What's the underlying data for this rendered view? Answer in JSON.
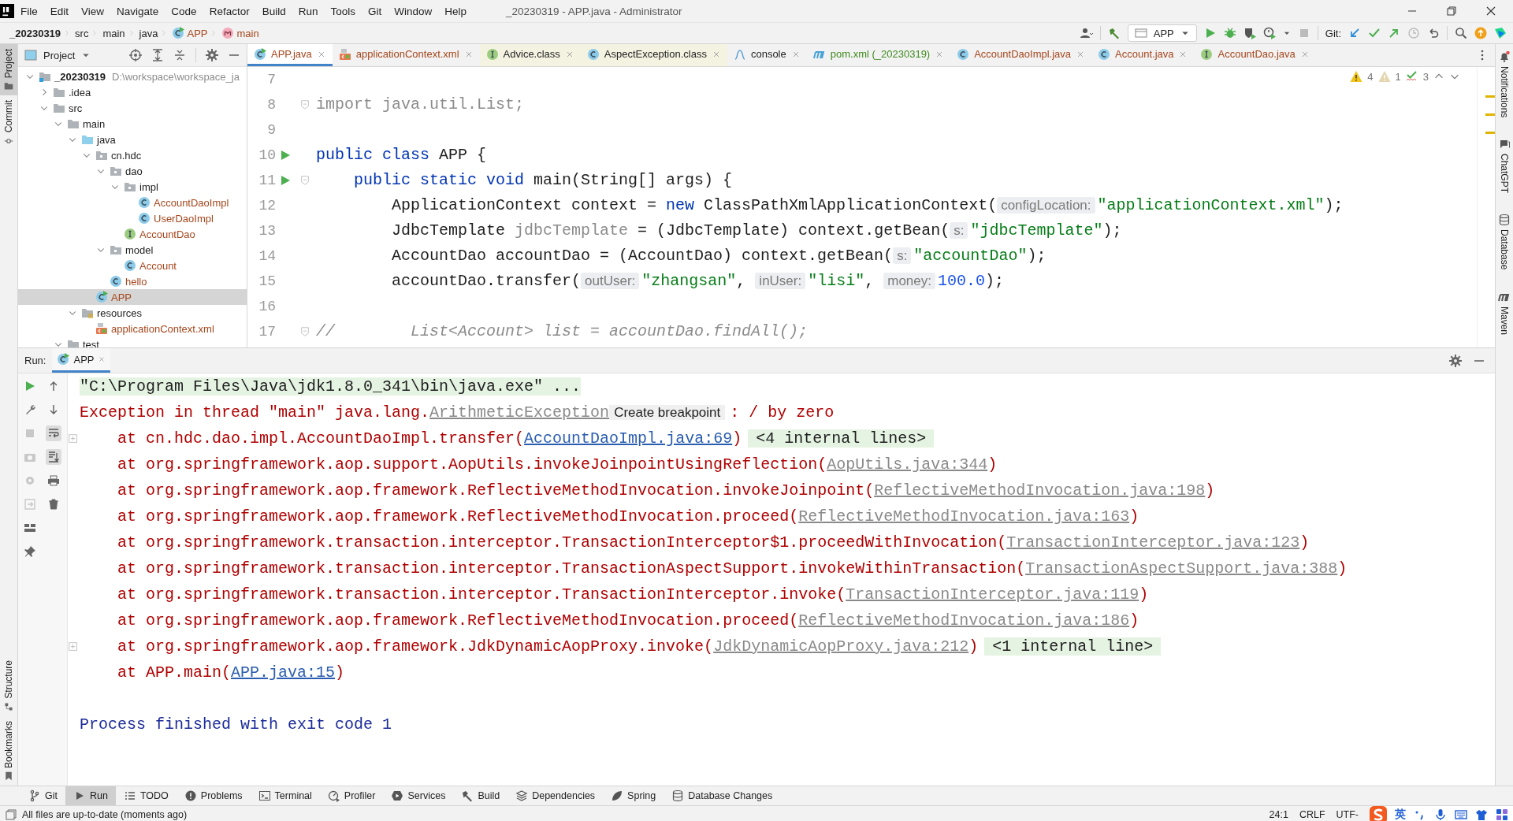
{
  "window": {
    "title": "_20230319 - APP.java - Administrator"
  },
  "menu": [
    "File",
    "Edit",
    "View",
    "Navigate",
    "Code",
    "Refactor",
    "Build",
    "Run",
    "Tools",
    "Git",
    "Window",
    "Help"
  ],
  "breadcrumbs": [
    {
      "label": "_20230319",
      "kind": "project"
    },
    {
      "label": "src",
      "kind": "folder"
    },
    {
      "label": "main",
      "kind": "folder"
    },
    {
      "label": "java",
      "kind": "folder"
    },
    {
      "label": "APP",
      "kind": "class"
    },
    {
      "label": "main",
      "kind": "method"
    }
  ],
  "toolbar": {
    "run_config": "APP",
    "git_label": "Git:"
  },
  "left_tool_strip": {
    "top": [
      {
        "label": "Project",
        "selected": true
      },
      {
        "label": "Commit",
        "selected": false
      }
    ],
    "bottom": [
      {
        "label": "Structure",
        "selected": false
      },
      {
        "label": "Bookmarks",
        "selected": false
      }
    ]
  },
  "right_tool_strip": [
    {
      "label": "Notifications",
      "kind": "bell"
    },
    {
      "label": "ChatGPT",
      "kind": "chat"
    },
    {
      "label": "Database",
      "kind": "database"
    },
    {
      "label": "Maven",
      "kind": "maven"
    }
  ],
  "project_panel": {
    "title": "Project",
    "tree": [
      {
        "label": "_20230319",
        "kind": "module",
        "path": "D:\\workspace\\workspace_ja",
        "expanded": true,
        "selected": false,
        "children": [
          {
            "label": ".idea",
            "kind": "folder",
            "expanded": false,
            "selected": false
          },
          {
            "label": "src",
            "kind": "folder",
            "expanded": true,
            "selected": false,
            "children": [
              {
                "label": "main",
                "kind": "folder",
                "expanded": true,
                "selected": false,
                "children": [
                  {
                    "label": "java",
                    "kind": "source-root",
                    "expanded": true,
                    "selected": false,
                    "children": [
                      {
                        "label": "cn.hdc",
                        "kind": "package",
                        "expanded": true,
                        "selected": false,
                        "children": [
                          {
                            "label": "dao",
                            "kind": "package",
                            "expanded": true,
                            "selected": false,
                            "children": [
                              {
                                "label": "impl",
                                "kind": "package",
                                "expanded": true,
                                "selected": false,
                                "children": [
                                  {
                                    "label": "AccountDaoImpl",
                                    "kind": "class",
                                    "selected": false
                                  },
                                  {
                                    "label": "UserDaoImpl",
                                    "kind": "class",
                                    "selected": false
                                  }
                                ]
                              },
                              {
                                "label": "AccountDao",
                                "kind": "interface",
                                "selected": false
                              }
                            ]
                          },
                          {
                            "label": "model",
                            "kind": "package",
                            "expanded": true,
                            "selected": false,
                            "children": [
                              {
                                "label": "Account",
                                "kind": "class",
                                "selected": false
                              }
                            ]
                          },
                          {
                            "label": "hello",
                            "kind": "class",
                            "selected": false
                          }
                        ]
                      },
                      {
                        "label": "APP",
                        "kind": "main-class",
                        "selected": true
                      }
                    ]
                  },
                  {
                    "label": "resources",
                    "kind": "resource-root",
                    "expanded": true,
                    "selected": false,
                    "children": [
                      {
                        "label": "applicationContext.xml",
                        "kind": "xml",
                        "selected": false
                      }
                    ]
                  }
                ]
              },
              {
                "label": "test",
                "kind": "folder",
                "expanded": true,
                "selected": false
              }
            ]
          }
        ]
      }
    ]
  },
  "editor_tabs": [
    {
      "label": "APP.java",
      "kind": "main-class",
      "selected": true,
      "library": false,
      "color": "#a5461c"
    },
    {
      "label": "applicationContext.xml",
      "kind": "xml",
      "selected": false,
      "library": false,
      "color": "#a5461c"
    },
    {
      "label": "Advice.class",
      "kind": "interface",
      "selected": false,
      "library": true,
      "color": "#1e1e1e"
    },
    {
      "label": "AspectException.class",
      "kind": "class",
      "selected": false,
      "library": true,
      "color": "#1e1e1e"
    },
    {
      "label": "console",
      "kind": "console",
      "selected": false,
      "library": false,
      "color": "#1e1e1e"
    },
    {
      "label": "pom.xml (_20230319)",
      "kind": "maven",
      "selected": false,
      "library": false,
      "color": "#3f8a1d"
    },
    {
      "label": "AccountDaoImpl.java",
      "kind": "class",
      "selected": false,
      "library": false,
      "color": "#a5461c"
    },
    {
      "label": "Account.java",
      "kind": "class",
      "selected": false,
      "library": false,
      "color": "#a5461c"
    },
    {
      "label": "AccountDao.java",
      "kind": "interface",
      "selected": false,
      "library": false,
      "color": "#a5461c"
    }
  ],
  "inspections": {
    "warnings": "4",
    "weak_warnings": "1",
    "typos": "3"
  },
  "code": [
    {
      "number": "7",
      "run_marker": false,
      "foldable": false
    },
    {
      "number": "8",
      "run_marker": false,
      "foldable": true,
      "tokens": [
        {
          "kind": "unused",
          "text": "import java.util.List;"
        }
      ]
    },
    {
      "number": "9",
      "run_marker": false,
      "foldable": false
    },
    {
      "number": "10",
      "run_marker": true,
      "foldable": false,
      "tokens": [
        {
          "kind": "keyword",
          "text": "public class"
        },
        {
          "kind": "plain",
          "text": " APP {"
        }
      ]
    },
    {
      "number": "11",
      "run_marker": true,
      "foldable": true,
      "tokens": [
        {
          "kind": "keyword",
          "text": "    public static void"
        },
        {
          "kind": "plain",
          "text": " main(String[] args) {"
        }
      ]
    },
    {
      "number": "12",
      "run_marker": false,
      "foldable": false,
      "tokens": [
        {
          "kind": "plain",
          "text": "        ApplicationContext context = "
        },
        {
          "kind": "keyword",
          "text": "new"
        },
        {
          "kind": "plain",
          "text": " ClassPathXmlApplicationContext("
        },
        {
          "kind": "hint",
          "text": "configLocation:"
        },
        {
          "kind": "string",
          "text": "\"applicationContext.xml\""
        },
        {
          "kind": "plain",
          "text": ");"
        }
      ]
    },
    {
      "number": "13",
      "run_marker": false,
      "foldable": false,
      "tokens": [
        {
          "kind": "plain",
          "text": "        JdbcTemplate "
        },
        {
          "kind": "unused",
          "text": "jdbcTemplate"
        },
        {
          "kind": "plain",
          "text": " = (JdbcTemplate) context.getBean("
        },
        {
          "kind": "hint",
          "text": "s:"
        },
        {
          "kind": "string",
          "text": "\"jdbcTemplate\""
        },
        {
          "kind": "plain",
          "text": ");"
        }
      ]
    },
    {
      "number": "14",
      "run_marker": false,
      "foldable": false,
      "tokens": [
        {
          "kind": "plain",
          "text": "        AccountDao accountDao = (AccountDao) context.getBean("
        },
        {
          "kind": "hint",
          "text": "s:"
        },
        {
          "kind": "string",
          "text": "\"accountDao\""
        },
        {
          "kind": "plain",
          "text": ");"
        }
      ]
    },
    {
      "number": "15",
      "run_marker": false,
      "foldable": false,
      "tokens": [
        {
          "kind": "plain",
          "text": "        accountDao.transfer("
        },
        {
          "kind": "hint",
          "text": "outUser:"
        },
        {
          "kind": "string",
          "text": "\"zhangsan\""
        },
        {
          "kind": "plain",
          "text": ", "
        },
        {
          "kind": "hint",
          "text": "inUser:"
        },
        {
          "kind": "string",
          "text": "\"lisi\""
        },
        {
          "kind": "plain",
          "text": ", "
        },
        {
          "kind": "hint",
          "text": "money:"
        },
        {
          "kind": "number",
          "text": "100.0"
        },
        {
          "kind": "plain",
          "text": ");"
        }
      ]
    },
    {
      "number": "16",
      "run_marker": false,
      "foldable": false
    },
    {
      "number": "17",
      "run_marker": false,
      "foldable": true,
      "tokens": [
        {
          "kind": "comment",
          "text": "//        List<Account> list = accountDao.findAll();"
        }
      ]
    }
  ],
  "run_panel": {
    "title": "Run:",
    "tab": "APP",
    "lines": [
      {
        "kind": "command",
        "foldable": false,
        "segments": [
          {
            "kind": "command",
            "text": "\"C:\\Program Files\\Java\\jdk1.8.0_341\\bin\\java.exe\" ..."
          }
        ]
      },
      {
        "kind": "error",
        "foldable": false,
        "segments": [
          {
            "kind": "error",
            "text": "Exception in thread \"main\" java.lang."
          },
          {
            "kind": "library-link",
            "text": "ArithmeticException"
          },
          {
            "kind": "tooltip",
            "text": "Create breakpoint"
          },
          {
            "kind": "error",
            "text": ": / by zero"
          }
        ]
      },
      {
        "kind": "trace",
        "foldable": true,
        "segments": [
          {
            "kind": "error",
            "text": "at cn.hdc.dao.impl.AccountDaoImpl.transfer("
          },
          {
            "kind": "link",
            "text": "AccountDaoImpl.java:69"
          },
          {
            "kind": "error",
            "text": ")"
          },
          {
            "kind": "folded",
            "text": "<4 internal lines>"
          }
        ]
      },
      {
        "kind": "trace",
        "foldable": false,
        "segments": [
          {
            "kind": "error",
            "text": "at org.springframework.aop.support.AopUtils.invokeJoinpointUsingReflection("
          },
          {
            "kind": "library-link",
            "text": "AopUtils.java:344"
          },
          {
            "kind": "error",
            "text": ")"
          }
        ]
      },
      {
        "kind": "trace",
        "foldable": false,
        "segments": [
          {
            "kind": "error",
            "text": "at org.springframework.aop.framework.ReflectiveMethodInvocation.invokeJoinpoint("
          },
          {
            "kind": "library-link",
            "text": "ReflectiveMethodInvocation.java:198"
          },
          {
            "kind": "error",
            "text": ")"
          }
        ]
      },
      {
        "kind": "trace",
        "foldable": false,
        "segments": [
          {
            "kind": "error",
            "text": "at org.springframework.aop.framework.ReflectiveMethodInvocation.proceed("
          },
          {
            "kind": "library-link",
            "text": "ReflectiveMethodInvocation.java:163"
          },
          {
            "kind": "error",
            "text": ")"
          }
        ]
      },
      {
        "kind": "trace",
        "foldable": false,
        "segments": [
          {
            "kind": "error",
            "text": "at org.springframework.transaction.interceptor.TransactionInterceptor$1.proceedWithInvocation("
          },
          {
            "kind": "library-link",
            "text": "TransactionInterceptor.java:123"
          },
          {
            "kind": "error",
            "text": ")"
          }
        ]
      },
      {
        "kind": "trace",
        "foldable": false,
        "segments": [
          {
            "kind": "error",
            "text": "at org.springframework.transaction.interceptor.TransactionAspectSupport.invokeWithinTransaction("
          },
          {
            "kind": "library-link",
            "text": "TransactionAspectSupport.java:388"
          },
          {
            "kind": "error",
            "text": ")"
          }
        ]
      },
      {
        "kind": "trace",
        "foldable": false,
        "segments": [
          {
            "kind": "error",
            "text": "at org.springframework.transaction.interceptor.TransactionInterceptor.invoke("
          },
          {
            "kind": "library-link",
            "text": "TransactionInterceptor.java:119"
          },
          {
            "kind": "error",
            "text": ")"
          }
        ]
      },
      {
        "kind": "trace",
        "foldable": false,
        "segments": [
          {
            "kind": "error",
            "text": "at org.springframework.aop.framework.ReflectiveMethodInvocation.proceed("
          },
          {
            "kind": "library-link",
            "text": "ReflectiveMethodInvocation.java:186"
          },
          {
            "kind": "error",
            "text": ")"
          }
        ]
      },
      {
        "kind": "trace",
        "foldable": true,
        "segments": [
          {
            "kind": "error",
            "text": "at org.springframework.aop.framework.JdkDynamicAopProxy.invoke("
          },
          {
            "kind": "library-link",
            "text": "JdkDynamicAopProxy.java:212"
          },
          {
            "kind": "error",
            "text": ")"
          },
          {
            "kind": "folded",
            "text": "<1 internal line>"
          }
        ]
      },
      {
        "kind": "trace",
        "foldable": false,
        "segments": [
          {
            "kind": "error",
            "text": "at APP.main("
          },
          {
            "kind": "link",
            "text": "APP.java:15"
          },
          {
            "kind": "error",
            "text": ")"
          }
        ]
      },
      {
        "kind": "blank"
      },
      {
        "kind": "info",
        "foldable": false,
        "segments": [
          {
            "kind": "info",
            "text": "Process finished with exit code 1"
          }
        ]
      }
    ]
  },
  "tool_tabs": [
    {
      "label": "Git",
      "kind": "git",
      "selected": false
    },
    {
      "label": "Run",
      "kind": "run",
      "selected": true
    },
    {
      "label": "TODO",
      "kind": "todo",
      "selected": false
    },
    {
      "label": "Problems",
      "kind": "problems",
      "selected": false
    },
    {
      "label": "Terminal",
      "kind": "terminal",
      "selected": false
    },
    {
      "label": "Profiler",
      "kind": "profiler",
      "selected": false
    },
    {
      "label": "Services",
      "kind": "services",
      "selected": false
    },
    {
      "label": "Build",
      "kind": "build",
      "selected": false
    },
    {
      "label": "Dependencies",
      "kind": "dependencies",
      "selected": false
    },
    {
      "label": "Spring",
      "kind": "spring",
      "selected": false
    },
    {
      "label": "Database Changes",
      "kind": "database",
      "selected": false
    }
  ],
  "status_bar": {
    "message": "All files are up-to-date (moments ago)",
    "position": "24:1",
    "line_separator": "CRLF",
    "encoding": "UTF-",
    "ime_mode": "英"
  }
}
